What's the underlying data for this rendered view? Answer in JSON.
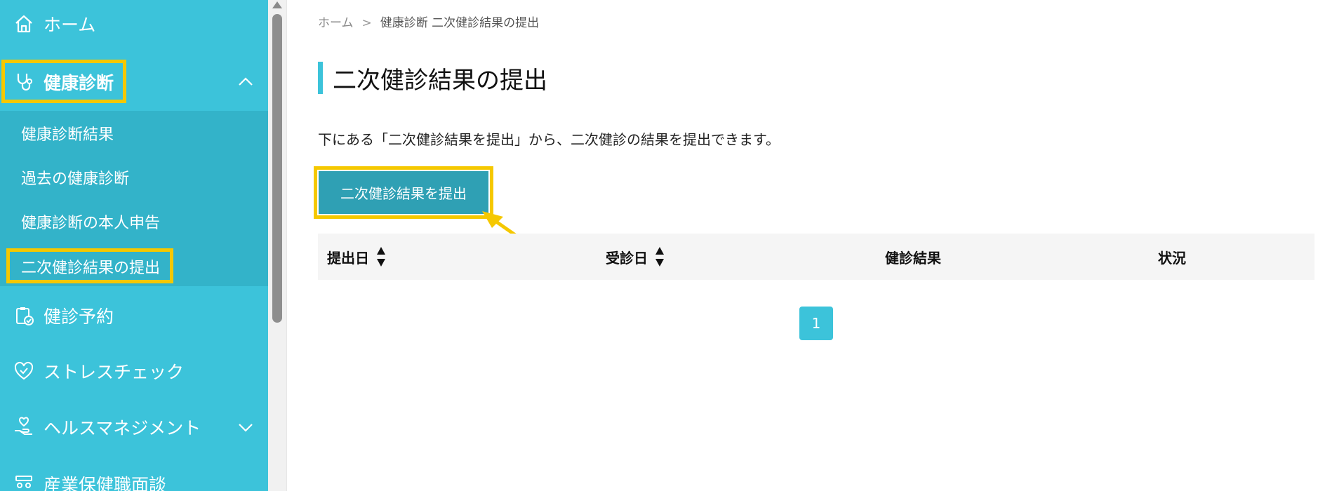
{
  "sidebar": {
    "home": "ホーム",
    "health_checkup": "健康診断",
    "submenu": [
      "健康診断結果",
      "過去の健康診断",
      "健康診断の本人申告",
      "二次健診結果の提出"
    ],
    "checkup_reservation": "健診予約",
    "stress_check": "ストレスチェック",
    "health_management": "ヘルスマネジメント",
    "occupational_health_interview": "産業保健職面談"
  },
  "breadcrumb": {
    "home": "ホーム",
    "current": "健康診断 二次健診結果の提出"
  },
  "main": {
    "title": "二次健診結果の提出",
    "description": "下にある「二次健診結果を提出」から、二次健診の結果を提出できます。",
    "submit_button": "二次健診結果を提出",
    "table_headers": [
      "提出日",
      "受診日",
      "健診結果",
      "状況"
    ],
    "current_page": "1"
  },
  "colors": {
    "sidebar_bg": "#3cc3da",
    "submenu_bg": "#33b3c9",
    "highlight": "#f5c800",
    "button_bg": "#2fa0b4"
  }
}
